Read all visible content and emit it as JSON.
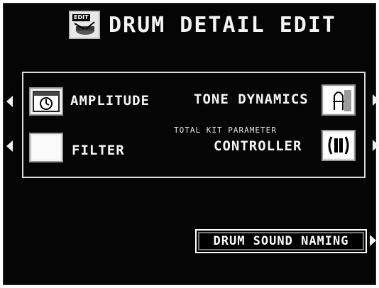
{
  "header": {
    "icon_tag": "EDIT",
    "title": "DRUM DETAIL EDIT"
  },
  "menu": {
    "amplitude_label": "AMPLITUDE",
    "filter_label": "FILTER",
    "tone_dynamics_label": "TONE DYNAMICS",
    "total_kit_caption": "TOTAL KIT PARAMETER",
    "controller_label": "CONTROLLER"
  },
  "bottom": {
    "drum_sound_naming_label": "DRUM SOUND NAMING"
  },
  "icons": {
    "edit": "edit-drum-icon",
    "amplitude": "amplitude-clock-icon",
    "filter": "filter-blank-icon",
    "tone_dynamics": "tone-dynamics-icon",
    "controller": "controller-icon",
    "arrows": "triangle-arrow-icon"
  },
  "colors": {
    "screen_bg": "#050505",
    "text": "#f5f5f5",
    "icon_bg": "#f0f0f0"
  }
}
